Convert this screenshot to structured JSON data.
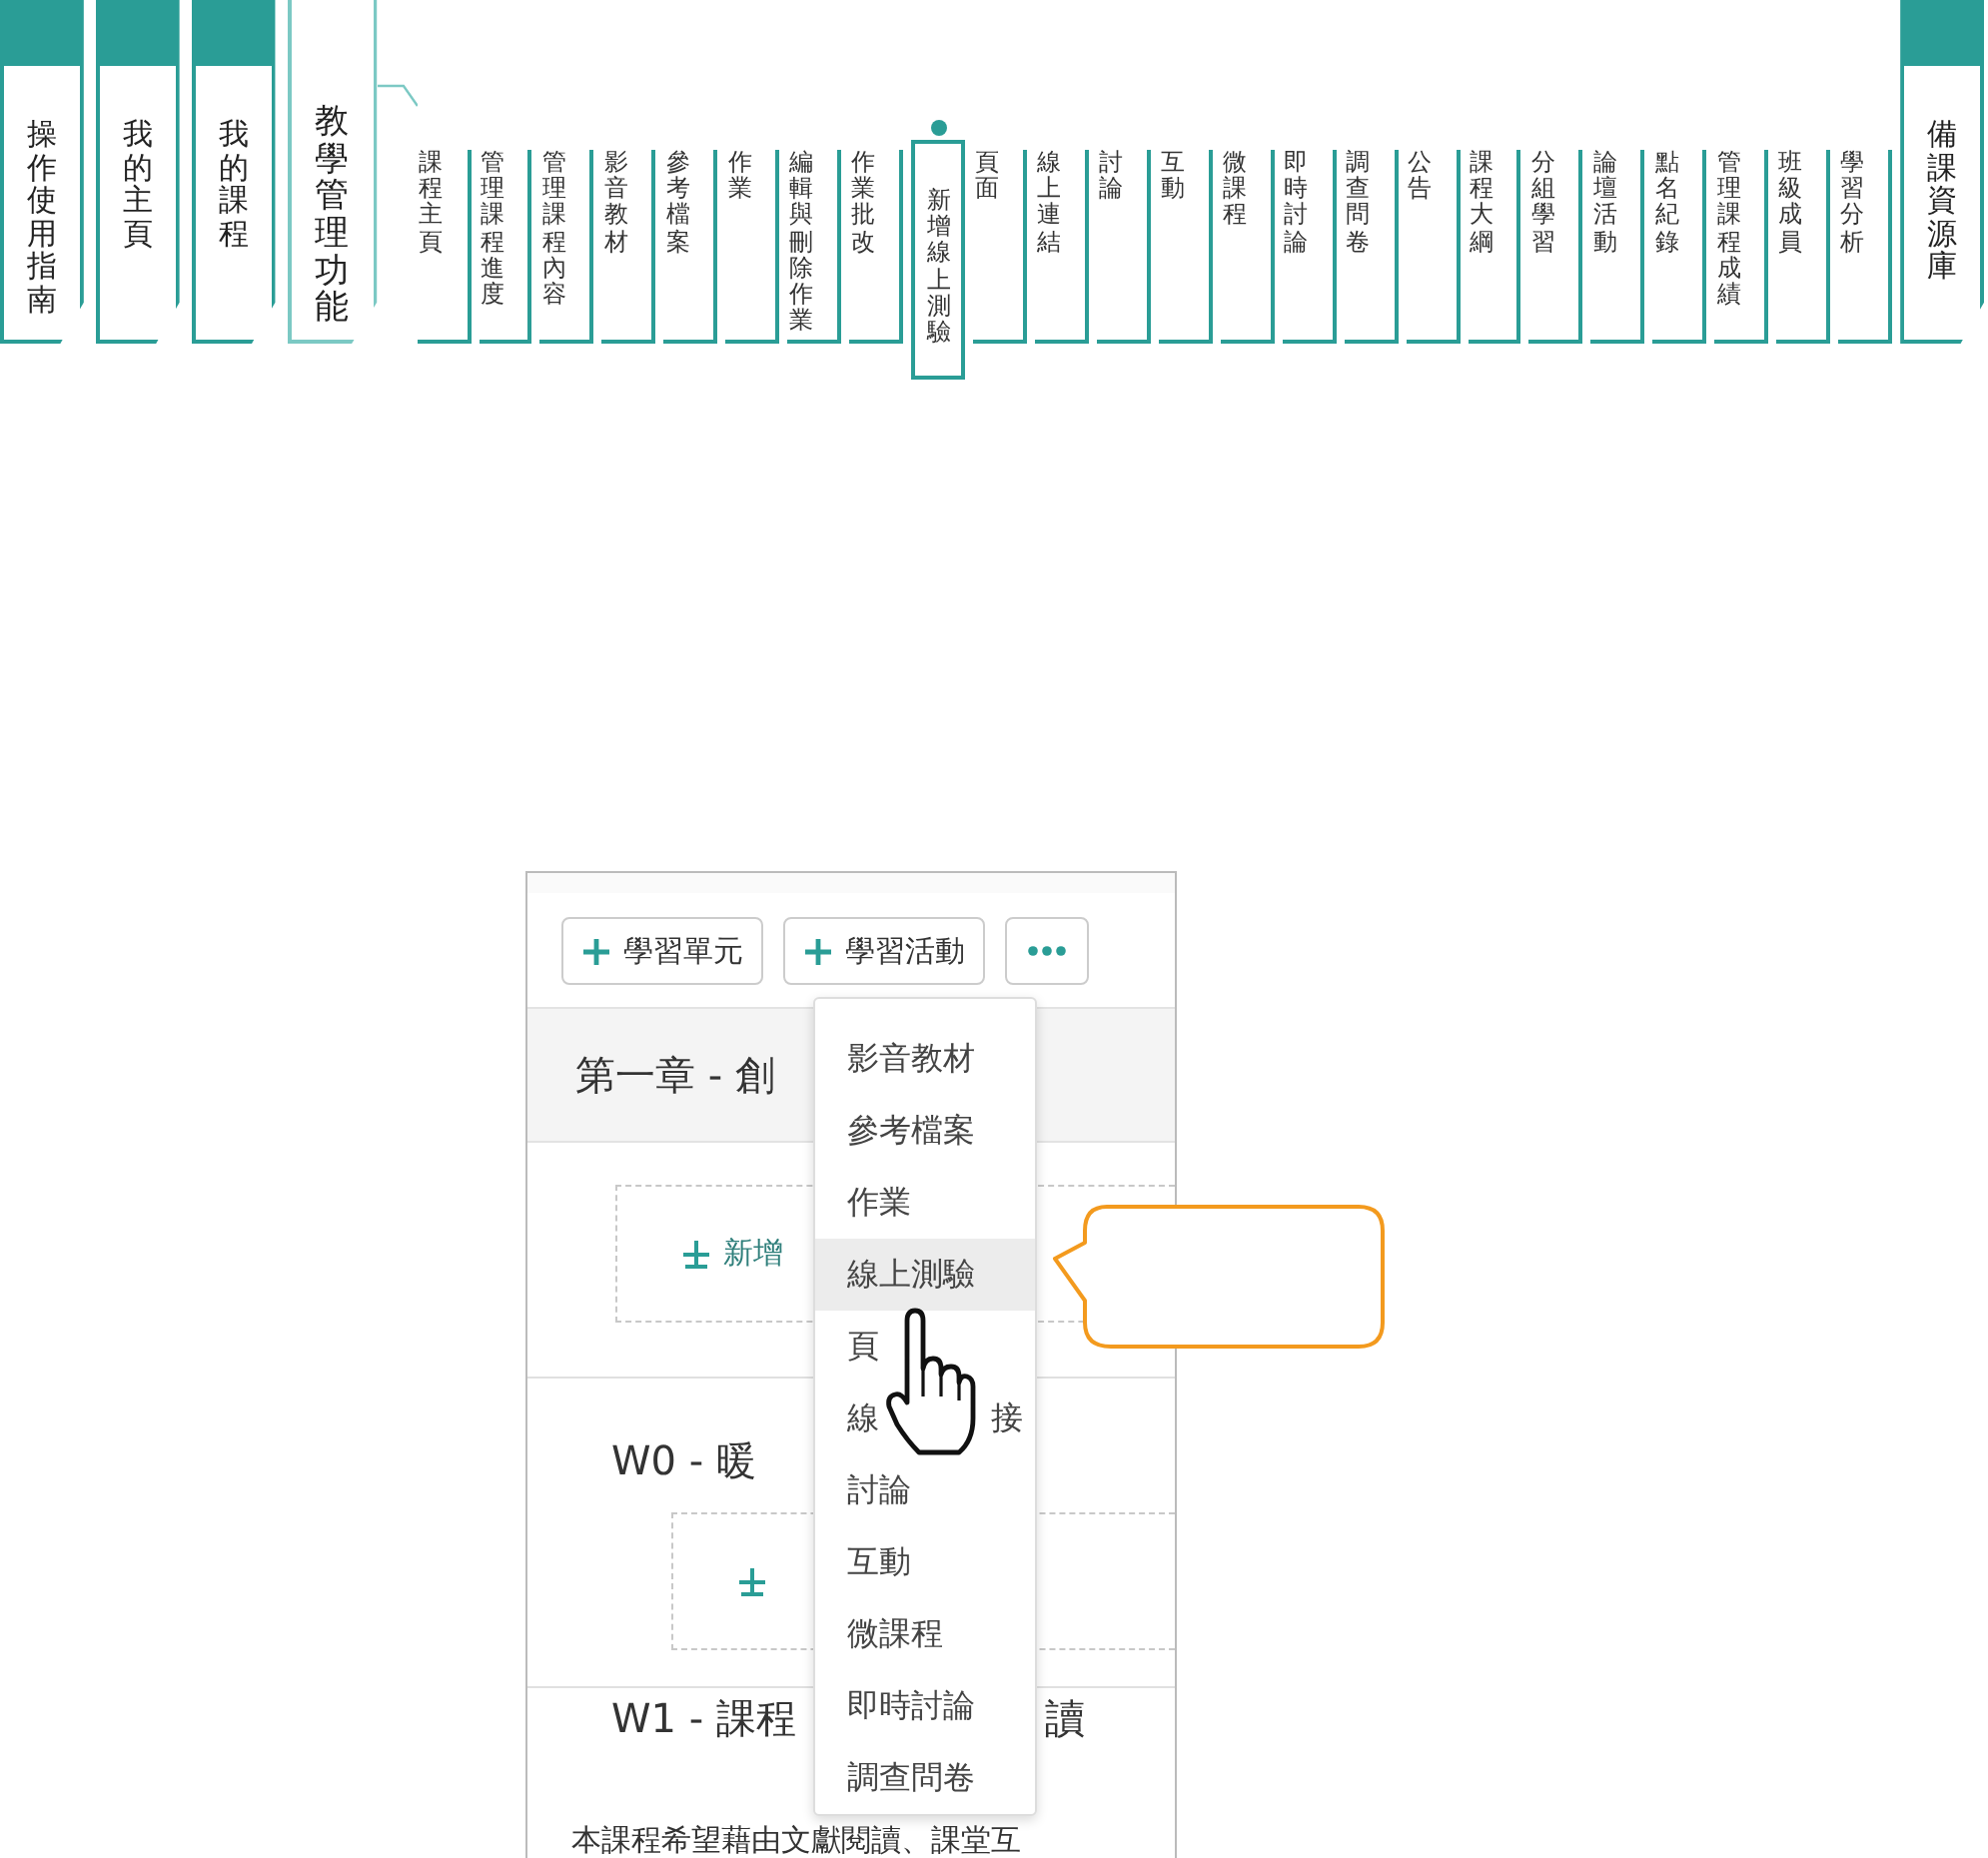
{
  "nav": {
    "tabs": [
      {
        "label": "操作使用指南",
        "selected": false
      },
      {
        "label": "我的主頁",
        "selected": false
      },
      {
        "label": "我的課程",
        "selected": false
      },
      {
        "label": "教學管理功能",
        "selected": true
      }
    ],
    "sub_items": [
      {
        "label": "課程主頁",
        "selected": false
      },
      {
        "label": "管理課程進度",
        "selected": false
      },
      {
        "label": "管理課程內容",
        "selected": false
      },
      {
        "label": "影音教材",
        "selected": false
      },
      {
        "label": "參考檔案",
        "selected": false
      },
      {
        "label": "作業",
        "selected": false
      },
      {
        "label": "編輯與刪除作業",
        "selected": false
      },
      {
        "label": "作業批改",
        "selected": false
      },
      {
        "label": "新增線上測驗",
        "selected": true
      },
      {
        "label": "頁面",
        "selected": false
      },
      {
        "label": "線上連結",
        "selected": false
      },
      {
        "label": "討論",
        "selected": false
      },
      {
        "label": "互動",
        "selected": false
      },
      {
        "label": "微課程",
        "selected": false
      },
      {
        "label": "即時討論",
        "selected": false
      },
      {
        "label": "調查問卷",
        "selected": false
      },
      {
        "label": "公告",
        "selected": false
      },
      {
        "label": "課程大綱",
        "selected": false
      },
      {
        "label": "分組學習",
        "selected": false
      },
      {
        "label": "論壇活動",
        "selected": false
      },
      {
        "label": "點名紀錄",
        "selected": false
      },
      {
        "label": "管理課程成績",
        "selected": false
      },
      {
        "label": "班級成員",
        "selected": false
      },
      {
        "label": "學習分析",
        "selected": false
      }
    ],
    "right_tab": {
      "label": "備課資源庫",
      "selected": false
    }
  },
  "editor": {
    "toolbar": [
      {
        "kind": "add",
        "label": "學習單元"
      },
      {
        "kind": "add",
        "label": "學習活動"
      },
      {
        "kind": "more"
      }
    ],
    "sections": [
      {
        "kind": "chapter",
        "title": "第一章 - 創",
        "add_label": "新增"
      },
      {
        "kind": "week",
        "title": "W0 - 暖"
      },
      {
        "kind": "week",
        "title": "W1 - 課程",
        "title_tail": "讀",
        "description": "本課程希望藉由文獻閱讀、課堂互"
      }
    ],
    "menu": {
      "items": [
        {
          "parts": [
            "影音教材"
          ],
          "selected": false
        },
        {
          "parts": [
            "參考檔案"
          ],
          "selected": false
        },
        {
          "parts": [
            "作業"
          ],
          "selected": false
        },
        {
          "parts": [
            "線上測驗"
          ],
          "selected": true
        },
        {
          "parts": [
            "頁"
          ],
          "selected": false
        },
        {
          "parts": [
            "線",
            "接"
          ],
          "selected": false
        },
        {
          "parts": [
            "討論"
          ],
          "selected": false
        },
        {
          "parts": [
            "互動"
          ],
          "selected": false
        },
        {
          "parts": [
            "微課程"
          ],
          "selected": false
        },
        {
          "parts": [
            "即時討論"
          ],
          "selected": false
        },
        {
          "parts": [
            "調查問卷"
          ],
          "selected": false
        }
      ]
    }
  }
}
